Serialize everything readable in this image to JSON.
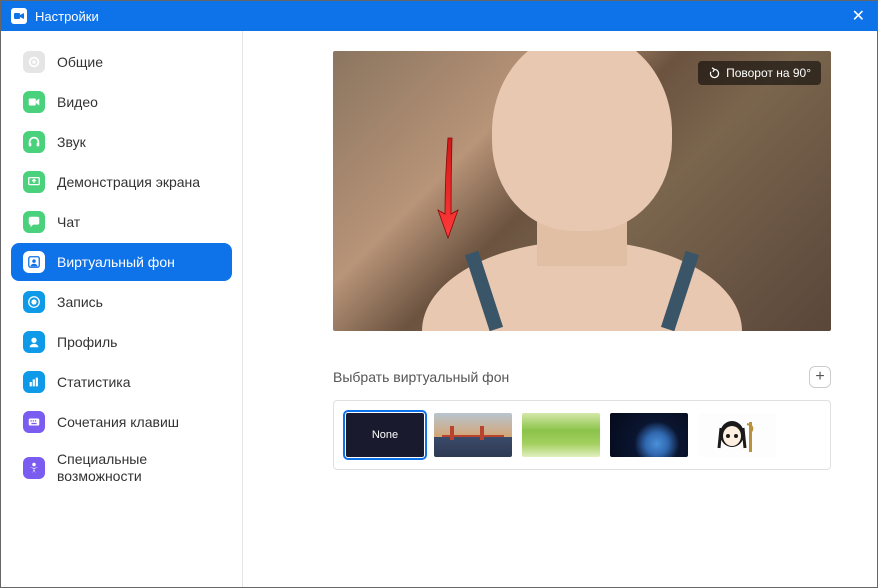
{
  "titlebar": {
    "title": "Настройки"
  },
  "sidebar": {
    "items": [
      {
        "label": "Общие"
      },
      {
        "label": "Видео"
      },
      {
        "label": "Звук"
      },
      {
        "label": "Демонстрация экрана"
      },
      {
        "label": "Чат"
      },
      {
        "label": "Виртуальный фон"
      },
      {
        "label": "Запись"
      },
      {
        "label": "Профиль"
      },
      {
        "label": "Статистика"
      },
      {
        "label": "Сочетания клавиш"
      },
      {
        "label": "Специальные возможности"
      }
    ]
  },
  "preview": {
    "rotate_label": "Поворот на 90°"
  },
  "section": {
    "choose_label": "Выбрать виртуальный фон"
  },
  "thumbs": {
    "none_label": "None"
  }
}
